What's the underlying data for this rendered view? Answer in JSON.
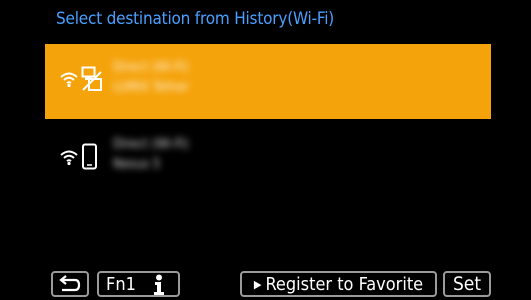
{
  "title": "Select destination from History(Wi-Fi)",
  "history": [
    {
      "line1": "Direct (Wi-Fi)",
      "line2": "LUMIX Tether",
      "icon": "wifi-pc-icon",
      "selected": true
    },
    {
      "line1": "Direct (Wi-Fi)",
      "line2": "Nexus 5",
      "icon": "wifi-smartphone-icon",
      "selected": false
    }
  ],
  "buttons": {
    "back_icon": "return-icon",
    "fn1_label": "Fn1",
    "info_icon": "info-icon",
    "register_label": "Register to Favorite",
    "set_label": "Set"
  },
  "colors": {
    "accent": "#f5a30b",
    "title": "#4aa0ff",
    "background": "#000000"
  }
}
